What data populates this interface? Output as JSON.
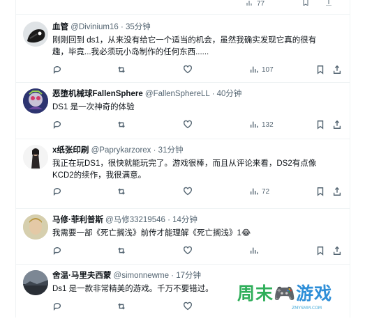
{
  "top_strip": {
    "views": "77"
  },
  "tweets": [
    {
      "name": "血管",
      "handle": "@Divinium16",
      "time": "35分钟",
      "text_lines": [
        "刚刚回到 ds1，从来没有给它一个适当的机会，虽然我确实发现它真的很有",
        "趣，毕竟...我必须玩小岛制作的任何东西......"
      ],
      "views": "107"
    },
    {
      "name": "恶堕机械球FallenSphere",
      "handle": "@FallenSphereLL",
      "time": "40分钟",
      "text_lines": [
        "DS1 是一次神奇的体验"
      ],
      "views": "132"
    },
    {
      "name": "x纸张印刷",
      "handle": "@Paprykarzorex",
      "time": "31分钟",
      "text_lines": [
        "我正在玩DS1，很快就能玩完了。游戏很棒，而且从评论来看，DS2有点像",
        "KCD2的续作，我很满意。"
      ],
      "views": "72"
    },
    {
      "name": "马修·菲利普斯",
      "handle": "@马修33219546",
      "time": "14分钟",
      "text_lines": [
        "我需要一部《死亡搁浅》前传才能理解《死亡搁浅》1😂"
      ],
      "views": ""
    },
    {
      "name": "舍温·马里夫西蒙",
      "handle": "@simonnewme",
      "time": "17分钟",
      "text_lines": [
        "Ds1 是一款非常精美的游戏。千万不要错过。"
      ],
      "views": ""
    }
  ],
  "separator": "·",
  "watermark": {
    "text": "周末🎮游戏",
    "sub": "ZMYSMM.COM"
  },
  "colors": {
    "text": "#0f1419",
    "muted": "#536471",
    "border": "#eff3f4",
    "watermark_green": "#2fae5a",
    "watermark_blue": "#2f8fd8"
  }
}
